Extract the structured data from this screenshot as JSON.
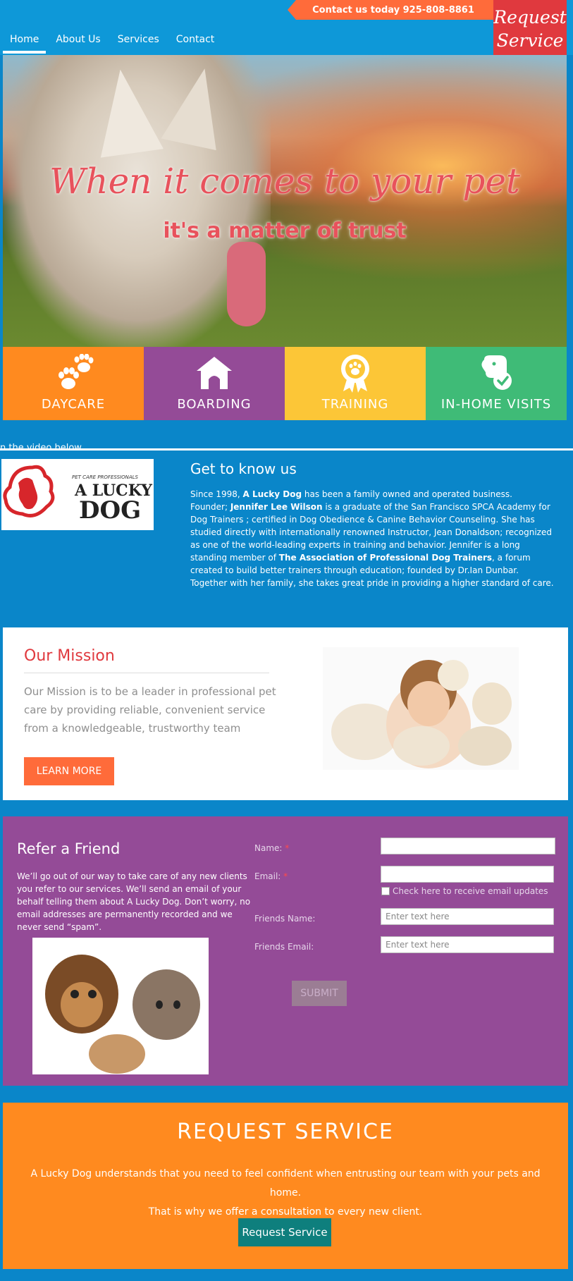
{
  "header": {
    "contact_text": "Contact us today 925-808-8861",
    "request_ribbon_line1": "Request",
    "request_ribbon_line2": "Service",
    "nav": [
      {
        "label": "Home",
        "active": true
      },
      {
        "label": "About Us"
      },
      {
        "label": "Services"
      },
      {
        "label": "Contact"
      }
    ]
  },
  "hero": {
    "title": "When it comes to your pet",
    "subtitle": "it's a matter of trust"
  },
  "services": [
    {
      "label": "DAYCARE",
      "color": "#ff8a1f",
      "icon": "paw-icon"
    },
    {
      "label": "BOARDING",
      "color": "#944b97",
      "icon": "dog-house-icon"
    },
    {
      "label": "TRAINING",
      "color": "#fcc637",
      "icon": "award-ribbon-icon"
    },
    {
      "label": "IN-HOME VISITS",
      "color": "#3fbb77",
      "icon": "dog-check-icon"
    }
  ],
  "stray_text": "n the video below",
  "about": {
    "logo_small": "PET CARE PROFESSIONALS",
    "logo_line1": "A LUCKY",
    "logo_line2": "DOG",
    "title": "Get to know us",
    "p1_pre": "Since 1998, ",
    "p1_bold": "A Lucky Dog",
    "p1_post": " has been a family owned and operated business.",
    "p2_pre": "Founder;   ",
    "p2_bold": "Jennifer Lee Wilson",
    "p2_mid": " is a graduate of the San Francisco SPCA Academy for Dog Trainers ; certified in Dog Obedience & Canine Behavior Counseling.  She has studied directly with internationally renowned Instructor, Jean Donaldson; recognized as one of the world-leading experts in training and behavior.  Jennifer is a long standing member of ",
    "p2_bold2": "The Association of Professional Dog Trainers",
    "p2_post": ", a forum created to build better trainers through education; founded by Dr.Ian Dunbar.  Together with her family, she takes great pride in providing a higher standard of care."
  },
  "mission": {
    "title": "Our Mission",
    "text": "Our Mission is to be a leader in professional pet care by providing reliable, convenient service from a knowledgeable, trustworthy team",
    "button": "LEARN MORE"
  },
  "refer": {
    "title": "Refer a Friend",
    "text": "We’ll go out of our way to take care of any new clients you refer to our services.  We’ll send an email of your behalf telling them about A Lucky Dog.  Don’t worry, no email addresses are permanently recorded and we never send “spam”.",
    "name_label": "Name:",
    "email_label": "Email:",
    "required_mark": "*",
    "checkbox_label": "Check here to receive email updates",
    "friends_name_label": "Friends Name:",
    "friends_email_label": "Friends Email:",
    "friends_name_placeholder": "Enter text here",
    "friends_email_placeholder": "Enter text here",
    "submit": "SUBMIT"
  },
  "request": {
    "title": "REQUEST SERVICE",
    "line1": "A Lucky Dog understands that you need to feel confident when entrusting our team with your pets and home.",
    "line2": "That is why we offer a consultation to every new client.",
    "button": "Request Service"
  }
}
